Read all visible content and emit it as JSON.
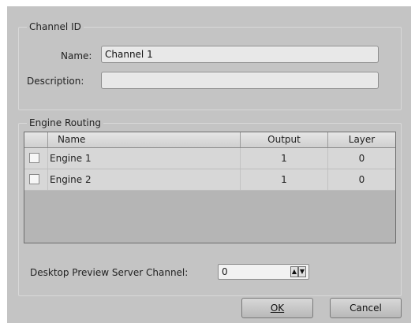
{
  "channel_id": {
    "legend": "Channel ID",
    "name_label": "Name:",
    "name_value": "Channel 1",
    "description_label": "Description:",
    "description_value": ""
  },
  "engine_routing": {
    "legend": "Engine Routing",
    "columns": [
      "Name",
      "Output",
      "Layer"
    ],
    "rows": [
      {
        "name": "Engine 1",
        "output": "1",
        "layer": "0",
        "checked": false
      },
      {
        "name": "Engine 2",
        "output": "1",
        "layer": "0",
        "checked": false
      }
    ]
  },
  "preview": {
    "label": "Desktop Preview Server Channel:",
    "value": "0"
  },
  "buttons": {
    "ok": "OK",
    "cancel": "Cancel"
  }
}
